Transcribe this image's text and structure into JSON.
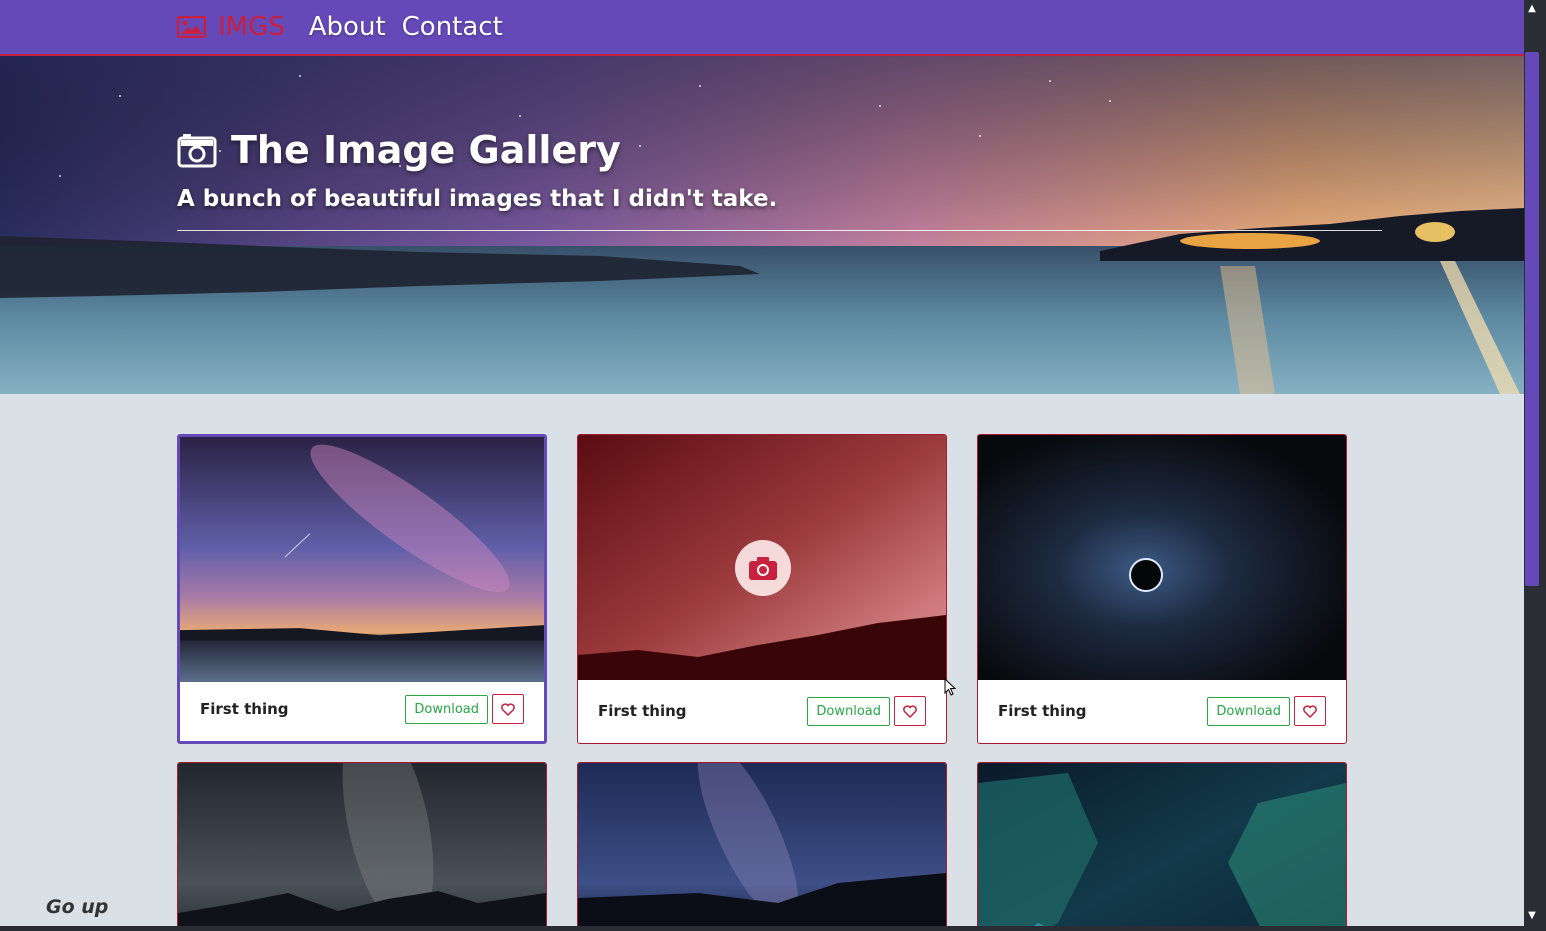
{
  "nav": {
    "brand": "IMGS",
    "links": [
      "About",
      "Contact"
    ]
  },
  "hero": {
    "title": "The Image Gallery",
    "subtitle": "A bunch of beautiful images that I didn't take."
  },
  "cards": [
    {
      "title": "First thing",
      "download_label": "Download"
    },
    {
      "title": "First thing",
      "download_label": "Download"
    },
    {
      "title": "First thing",
      "download_label": "Download"
    }
  ],
  "go_up": "Go up",
  "colors": {
    "nav_bg": "#6549b9",
    "brand_red": "#c8203f",
    "download_green": "#28a745",
    "page_bg": "#d9e1e6"
  },
  "icons": [
    "image-icon",
    "camera-icon",
    "heart-icon"
  ]
}
